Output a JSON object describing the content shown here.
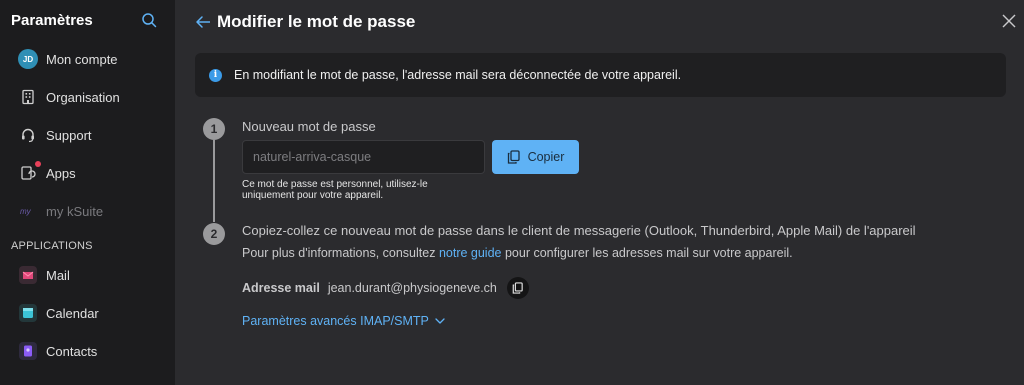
{
  "sidebar": {
    "title": "Paramètres",
    "items": [
      {
        "label": "Mon compte",
        "avatar": "JD"
      },
      {
        "label": "Organisation",
        "icon": "building-icon"
      },
      {
        "label": "Support",
        "icon": "headset-icon"
      },
      {
        "label": "Apps",
        "icon": "apps-sync-icon"
      },
      {
        "label": "my kSuite",
        "icon": "my-ksuite-icon"
      }
    ],
    "section_label": "APPLICATIONS",
    "apps": [
      {
        "label": "Mail",
        "color": "#e0487a"
      },
      {
        "label": "Calendar",
        "color": "#3cc3d6"
      },
      {
        "label": "Contacts",
        "color": "#8b5cf6"
      }
    ]
  },
  "header": {
    "title": "Modifier le mot de passe"
  },
  "info_banner": {
    "text": "En modifiant le mot de passe, l'adresse mail sera déconnectée de votre appareil."
  },
  "step1": {
    "number": "1",
    "label": "Nouveau mot de passe",
    "password_placeholder": "naturel-arriva-casque",
    "copy_label": "Copier",
    "hint": "Ce mot de passe est personnel, utilisez-le uniquement pour votre appareil."
  },
  "step2": {
    "number": "2",
    "label": "Copiez-collez ce nouveau mot de passe dans le client de messagerie (Outlook, Thunderbird, Apple Mail) de l'appareil",
    "info_prefix": "Pour plus d'informations, consultez ",
    "info_link": "notre guide",
    "info_suffix": " pour configurer les adresses mail sur votre appareil.",
    "mail_label": "Adresse mail",
    "mail_value": "jean.durant@physiogeneve.ch",
    "advanced_link": "Paramètres avancés IMAP/SMTP"
  },
  "colors": {
    "accent": "#5fb2f5",
    "sidebar_bg": "#1c1c1e",
    "main_bg": "#2b2b2e"
  }
}
